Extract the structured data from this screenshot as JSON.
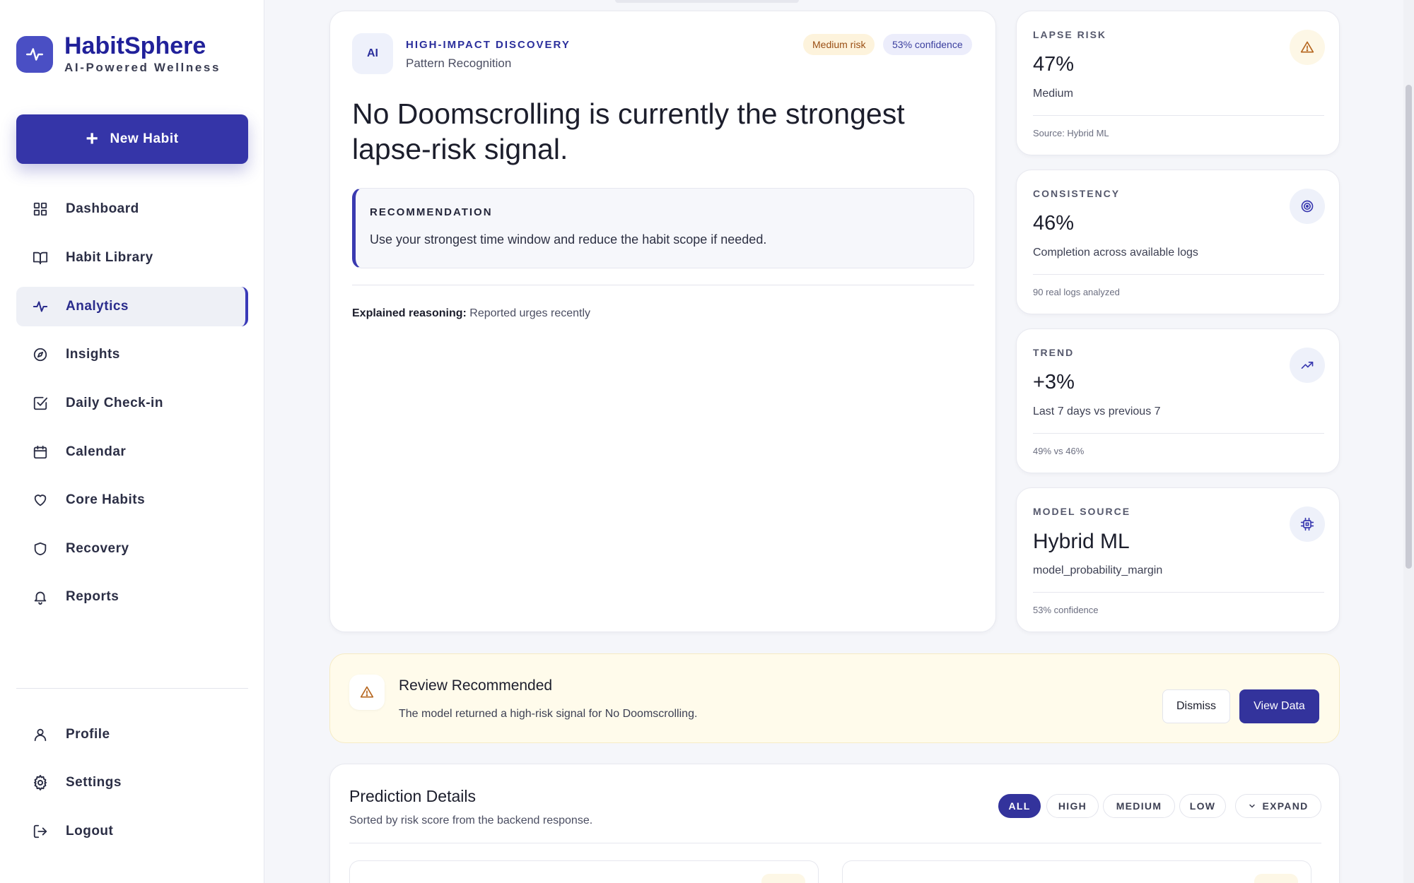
{
  "brand": {
    "name": "HabitSphere",
    "tagline": "AI-Powered Wellness"
  },
  "sidebar": {
    "new_habit_label": "New Habit",
    "items": [
      {
        "label": "Dashboard",
        "icon": "grid-icon"
      },
      {
        "label": "Habit Library",
        "icon": "book-icon"
      },
      {
        "label": "Analytics",
        "icon": "activity-icon",
        "active": true
      },
      {
        "label": "Insights",
        "icon": "compass-icon"
      },
      {
        "label": "Daily Check-in",
        "icon": "check-square-icon"
      },
      {
        "label": "Calendar",
        "icon": "calendar-icon"
      },
      {
        "label": "Core Habits",
        "icon": "heart-icon"
      },
      {
        "label": "Recovery",
        "icon": "shield-icon"
      },
      {
        "label": "Reports",
        "icon": "bell-icon"
      }
    ],
    "bottom_items": [
      {
        "label": "Profile",
        "icon": "user-icon"
      },
      {
        "label": "Settings",
        "icon": "gear-icon"
      },
      {
        "label": "Logout",
        "icon": "logout-icon"
      }
    ]
  },
  "hero": {
    "badge": "AI",
    "eyebrow": "HIGH-IMPACT DISCOVERY",
    "subtitle": "Pattern Recognition",
    "risk_pill": "Medium risk",
    "confidence_pill": "53% confidence",
    "title": "No Doomscrolling is currently the strongest lapse-risk signal.",
    "recommendation_label": "RECOMMENDATION",
    "recommendation_text": "Use your strongest time window and reduce the habit scope if needed.",
    "reasoning_label": "Explained reasoning:",
    "reasoning_text": "Reported urges recently"
  },
  "stats": [
    {
      "label": "LAPSE RISK",
      "value": "47%",
      "desc": "Medium",
      "foot": "Source: Hybrid ML",
      "icon": "warning-icon"
    },
    {
      "label": "CONSISTENCY",
      "value": "46%",
      "desc": "Completion across available logs",
      "foot": "90 real logs analyzed",
      "icon": "target-icon"
    },
    {
      "label": "TREND",
      "value": "+3%",
      "desc": "Last 7 days vs previous 7",
      "foot": "49% vs 46%",
      "icon": "trending-up-icon"
    },
    {
      "label": "MODEL SOURCE",
      "value": "Hybrid ML",
      "desc": "model_probability_margin",
      "foot": "53% confidence",
      "icon": "cpu-icon"
    }
  ],
  "banner": {
    "title": "Review Recommended",
    "text": "The model returned a high-risk signal for No Doomscrolling.",
    "dismiss_label": "Dismiss",
    "view_label": "View Data"
  },
  "predictions": {
    "title": "Prediction Details",
    "subtitle": "Sorted by risk score from the backend response.",
    "filters": [
      "ALL",
      "HIGH",
      "MEDIUM",
      "LOW"
    ],
    "expand_label": "EXPAND"
  },
  "colors": {
    "primary": "#33339c",
    "accent": "#4a4fc4",
    "warning": "#b5651d"
  }
}
